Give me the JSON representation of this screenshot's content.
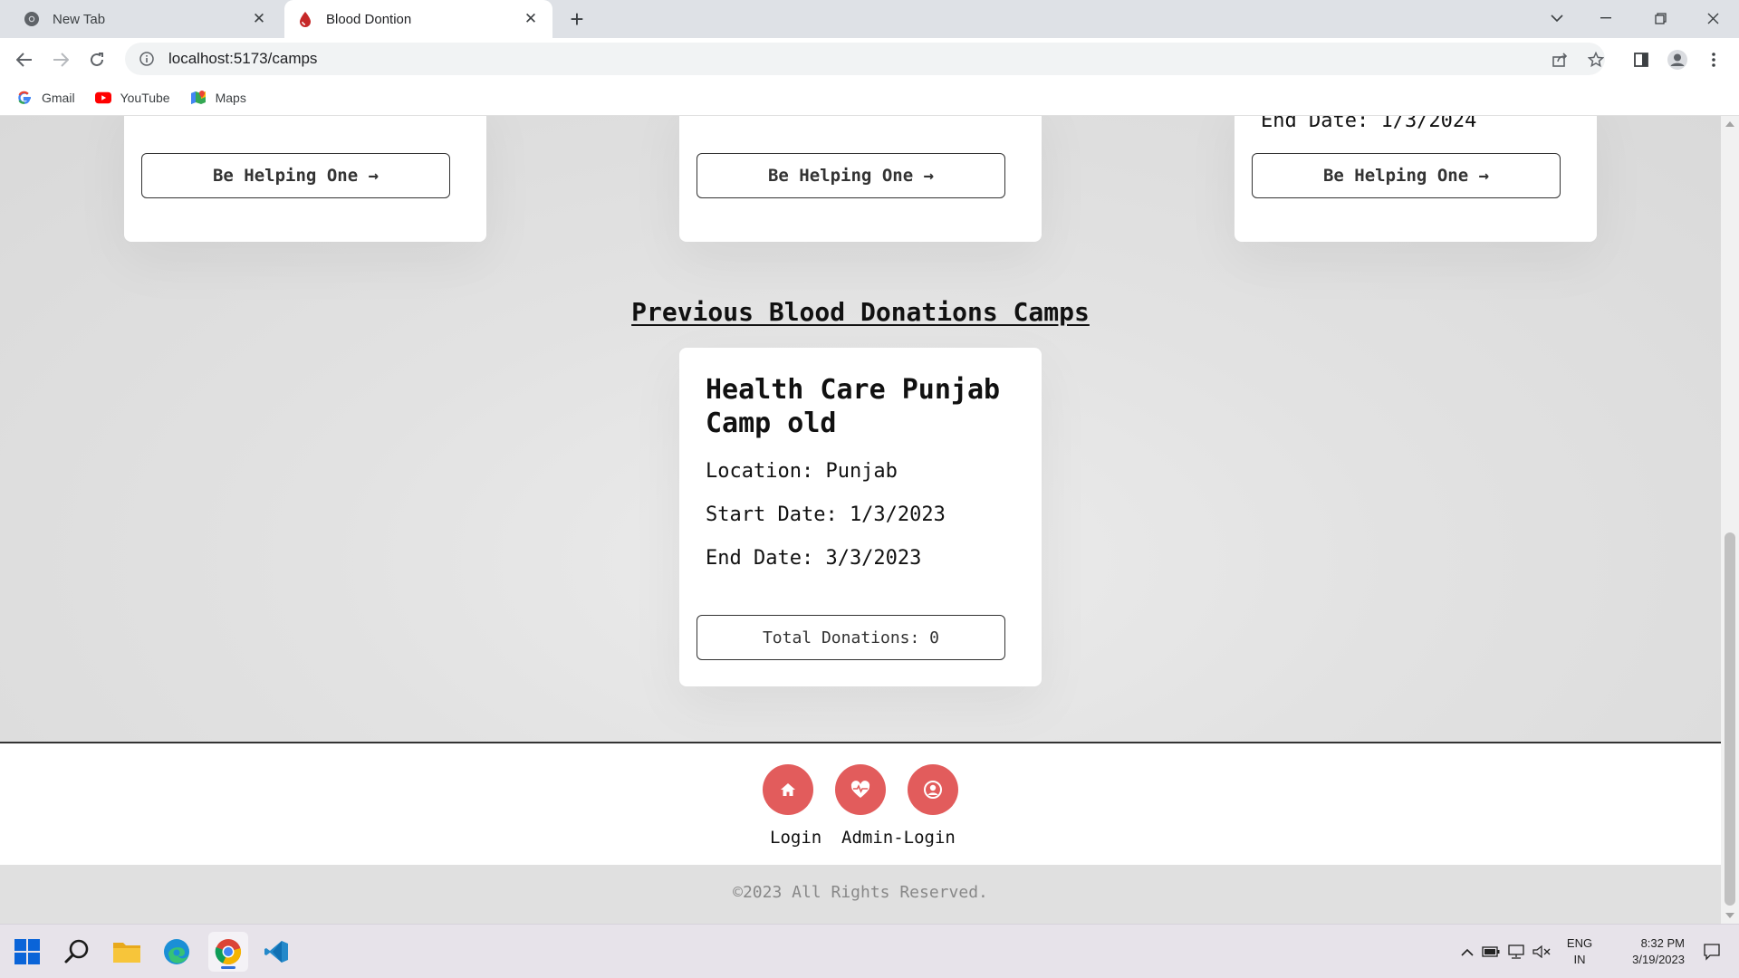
{
  "browser": {
    "tabs": [
      {
        "title": "New Tab",
        "favicon": "chrome-icon",
        "active": false
      },
      {
        "title": "Blood Dontion",
        "favicon": "blood-drop-icon",
        "active": true
      }
    ],
    "url": "localhost:5173/camps",
    "bookmarks": [
      {
        "label": "Gmail",
        "icon": "google-icon"
      },
      {
        "label": "YouTube",
        "icon": "youtube-icon"
      },
      {
        "label": "Maps",
        "icon": "maps-icon"
      }
    ]
  },
  "upcoming": {
    "cards": [
      {
        "button": "Be Helping One  →"
      },
      {
        "button": "Be Helping One  →"
      },
      {
        "end_date": "End Date: 1/3/2024",
        "button": "Be Helping One  →"
      }
    ]
  },
  "previous": {
    "title": "Previous Blood Donations Camps",
    "card": {
      "name": "Health Care Punjab Camp old",
      "location": "Location: Punjab",
      "start_date": "Start Date: 1/3/2023",
      "end_date": "End Date: 3/3/2023",
      "total": "Total Donations: 0"
    }
  },
  "footer": {
    "icons": [
      "home-icon",
      "heart-pulse-icon",
      "user-circle-icon"
    ],
    "links": [
      "Login",
      "Admin-Login"
    ],
    "copyright": "©2023 All Rights Reserved."
  },
  "taskbar": {
    "apps": [
      "windows-start-icon",
      "search-icon",
      "file-explorer-icon",
      "edge-icon",
      "chrome-icon",
      "vscode-icon"
    ],
    "lang_top": "ENG",
    "lang_bottom": "IN",
    "time": "8:32 PM",
    "date": "3/19/2023"
  },
  "colors": {
    "accent_red": "#e25c5c",
    "page_bg": "#dedede",
    "card_bg": "#ffffff"
  }
}
